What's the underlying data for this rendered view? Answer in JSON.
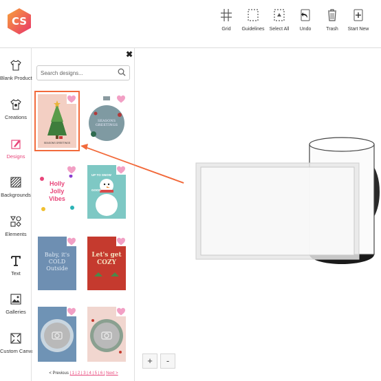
{
  "brand": {
    "logo_text": "CS",
    "logo_color": "#ee4d5b"
  },
  "toolbar": {
    "grid": "Grid",
    "guidelines": "Guidelines",
    "select_all": "Select All",
    "undo": "Undo",
    "trash": "Trash",
    "start_new": "Start New"
  },
  "sidebar": {
    "items": [
      {
        "label": "Blank Products",
        "icon": "tshirt-icon"
      },
      {
        "label": "Creations",
        "icon": "shirt-design-icon"
      },
      {
        "label": "Designs",
        "icon": "design-icon",
        "active": true
      },
      {
        "label": "Backgrounds",
        "icon": "stripes-icon"
      },
      {
        "label": "Elements",
        "icon": "shapes-icon"
      },
      {
        "label": "Text",
        "icon": "text-icon"
      },
      {
        "label": "Galleries",
        "icon": "image-icon"
      },
      {
        "label": "Custom Canvas",
        "icon": "canvas-icon"
      }
    ],
    "active_color": "#e8457a"
  },
  "designs_panel": {
    "search_placeholder": "Search designs...",
    "designs": [
      {
        "caption": "SEASONS GREETINGS"
      },
      {
        "caption": "SEASONS GREETINGS"
      },
      {
        "caption": "Holly Jolly Vibes"
      },
      {
        "caption": "UP TO SNOW GOOD"
      },
      {
        "caption": "Baby, it's COLD Outside"
      },
      {
        "caption": "Let's get COZY"
      }
    ],
    "pager": {
      "previous": "< Previous",
      "pages": "| 1 | 2 | 3 | 4 | 5 | 6 |",
      "next": "Next >"
    }
  },
  "canvas": {
    "zoom_in": "+",
    "zoom_out": "-",
    "arrow_color": "#f26a3b"
  }
}
